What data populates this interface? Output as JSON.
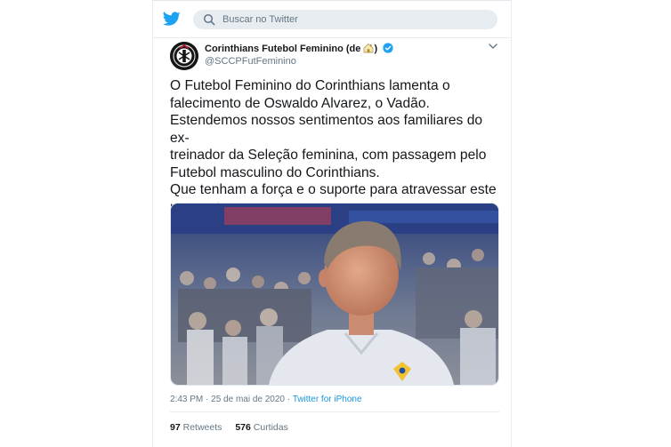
{
  "search": {
    "placeholder": "Buscar no Twitter"
  },
  "tweet": {
    "author": {
      "display_name": "Corinthians Futebol Feminino (de",
      "display_name_suffix": ")",
      "handle": "@SCCPFutFeminino",
      "verified": true
    },
    "text": "O Futebol Feminino do Corinthians lamenta o\nfalecimento de Oswaldo Alvarez, o Vadão.\nEstendemos nossos sentimentos aos familiares do ex-\ntreinador da Seleção feminina, com passagem pelo\nFutebol masculino do Corinthians.\nQue tenham a força e o suporte para atravessar este\nmomento.",
    "meta": {
      "time": "2:43 PM",
      "separator": " · ",
      "date": "25 de mai de 2020",
      "separator2": " · ",
      "source": "Twitter for iPhone"
    },
    "stats": {
      "retweets_count": "97",
      "retweets_label": "Retweets",
      "likes_count": "576",
      "likes_label": "Curtidas"
    }
  },
  "colors": {
    "brand_blue": "#1da1f2",
    "link_blue": "#1b95e0",
    "text_secondary": "#657786"
  },
  "icons": {
    "logo": "twitter-bird-icon",
    "search": "search-icon",
    "verified": "verified-badge-icon",
    "house": "house-emoji-icon",
    "caret": "chevron-down-icon"
  }
}
